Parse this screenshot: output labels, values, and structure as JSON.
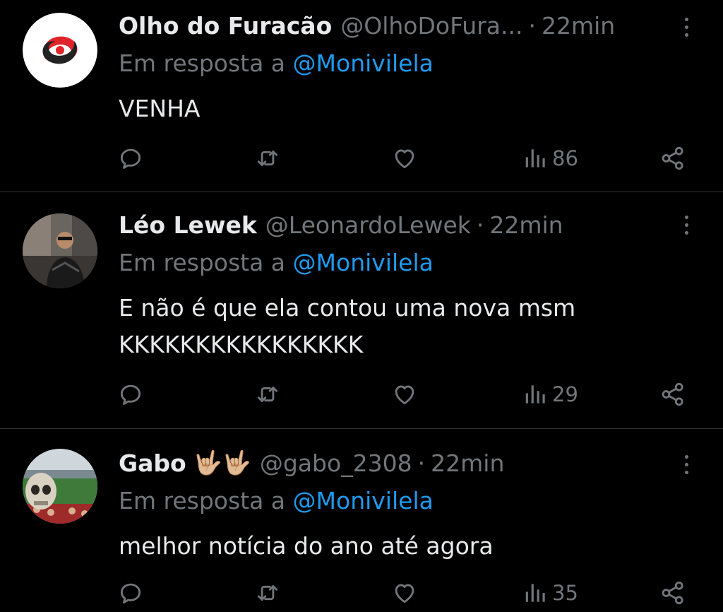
{
  "colors": {
    "background": "#000000",
    "text": "#e7e9ea",
    "muted": "#71767b",
    "link": "#1d9bf0",
    "divider": "#2f3336"
  },
  "tweets": [
    {
      "display_name": "Olho do Furacão",
      "handle": "@OlhoDoFura...",
      "separator": "·",
      "time": "22min",
      "replying_label": "Em resposta a",
      "replying_to": "@Monivilela",
      "text": "VENHA",
      "views": "86",
      "avatar": "hurricane-logo",
      "icons": [
        "reply-icon",
        "retweet-icon",
        "like-icon",
        "views-icon",
        "share-icon",
        "more-icon"
      ]
    },
    {
      "display_name": "Léo Lewek",
      "handle": "@LeonardoLewek",
      "separator": "·",
      "time": "22min",
      "replying_label": "Em resposta a",
      "replying_to": "@Monivilela",
      "text": "E não é que ela contou uma nova msm\nKKKKKKKKKKKKKKKK",
      "views": "29",
      "avatar": "person-photo",
      "icons": [
        "reply-icon",
        "retweet-icon",
        "like-icon",
        "views-icon",
        "share-icon",
        "more-icon"
      ]
    },
    {
      "display_name": "Gabo",
      "name_emoji": "🤟🏼🤟🏼",
      "handle": "@gabo_2308",
      "separator": "·",
      "time": "22min",
      "replying_label": "Em resposta a",
      "replying_to": "@Monivilela",
      "text": "melhor notícia do ano até agora",
      "views": "35",
      "avatar": "skull-stadium-photo",
      "icons": [
        "reply-icon",
        "retweet-icon",
        "like-icon",
        "views-icon",
        "share-icon",
        "more-icon"
      ]
    }
  ]
}
